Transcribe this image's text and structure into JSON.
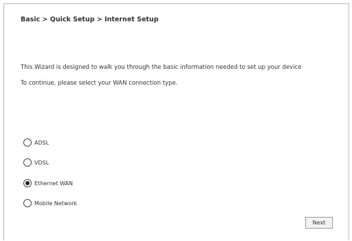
{
  "header": {
    "breadcrumb": "Basic > Quick Setup > Internet Setup"
  },
  "intro": {
    "line1": "This Wizard is designed to walk you through the basic information needed to set up your device",
    "line2": "To continue, please select your WAN connection type."
  },
  "wan_options": [
    {
      "label": "ADSL",
      "selected": false
    },
    {
      "label": "VDSL",
      "selected": false
    },
    {
      "label": "Ethernet WAN",
      "selected": true
    },
    {
      "label": "Mobile Network",
      "selected": false
    }
  ],
  "actions": {
    "next_label": "Next"
  }
}
